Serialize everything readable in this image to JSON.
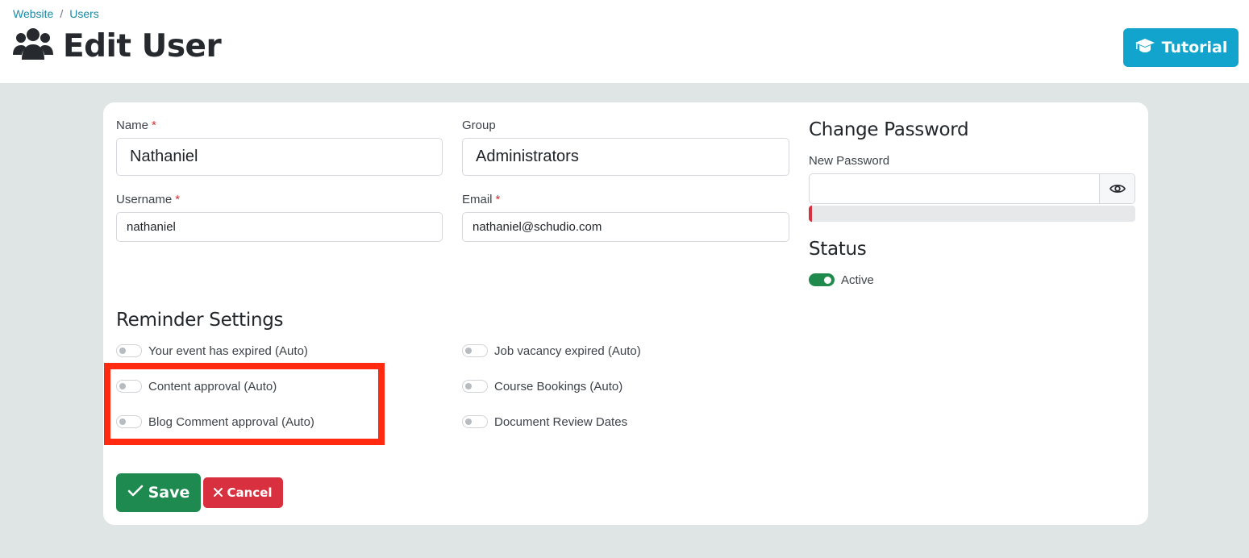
{
  "breadcrumb": {
    "website": "Website",
    "separator": "/",
    "users": "Users"
  },
  "page": {
    "title": "Edit User",
    "title_icon": "users-icon"
  },
  "header": {
    "tutorial_label": "Tutorial",
    "tutorial_icon": "graduation-cap-icon"
  },
  "form": {
    "name_label": "Name",
    "name_value": "Nathaniel",
    "group_label": "Group",
    "group_value": "Administrators",
    "username_label": "Username",
    "username_value": "nathaniel",
    "email_label": "Email",
    "email_value": "nathaniel@schudio.com",
    "required_mark": "*"
  },
  "password": {
    "heading": "Change Password",
    "new_label": "New Password",
    "new_value": "",
    "eye_icon": "eye-icon",
    "strength_fraction": 0.01,
    "strength_color": "#d9303e"
  },
  "status": {
    "heading": "Status",
    "active_label": "Active",
    "active_on": true,
    "on_color": "#1f8a4c"
  },
  "reminders": {
    "heading": "Reminder Settings",
    "items": [
      {
        "label": "Your event has expired (Auto)",
        "on": false
      },
      {
        "label": "Job vacancy expired (Auto)",
        "on": false
      },
      {
        "label": "Content approval (Auto)",
        "on": false
      },
      {
        "label": "Course Bookings (Auto)",
        "on": false
      },
      {
        "label": "Blog Comment approval (Auto)",
        "on": false
      },
      {
        "label": "Document Review Dates",
        "on": false
      }
    ]
  },
  "actions": {
    "save_label": "Save",
    "cancel_label": "Cancel",
    "save_color": "#1e8a4f",
    "cancel_color": "#d8303f"
  },
  "colors": {
    "accent": "#12a4cc",
    "link": "#1a8aa3",
    "highlight": "#ff2a10"
  }
}
